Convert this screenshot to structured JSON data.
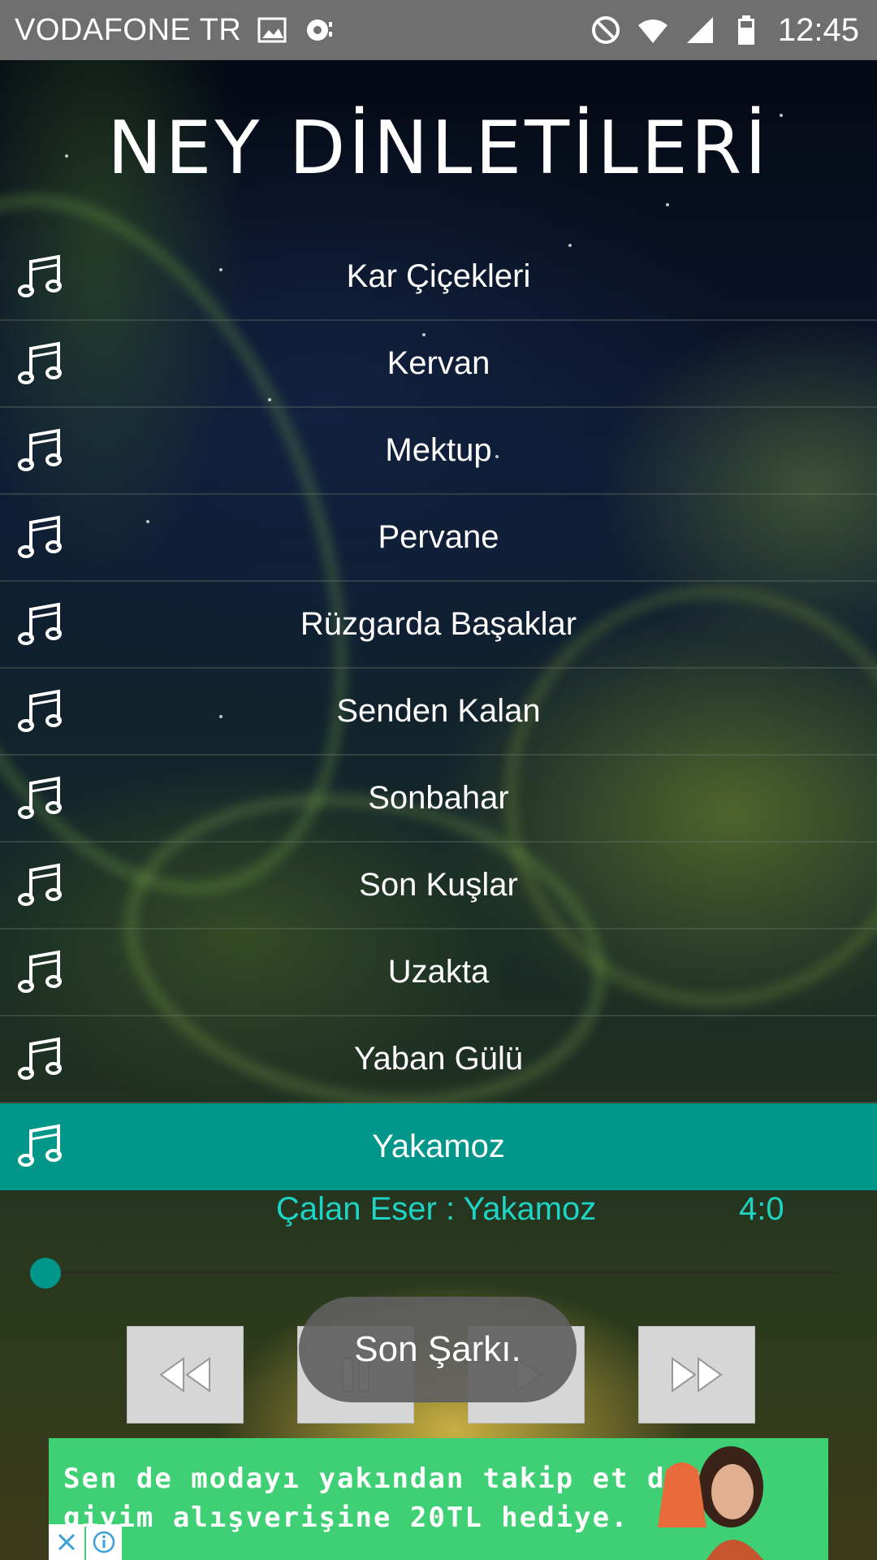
{
  "status_bar": {
    "carrier": "VODAFONE TR",
    "time": "12:45",
    "icons": [
      "image-icon",
      "cast-icon",
      "do-not-disturb-icon",
      "wifi-icon",
      "signal-icon",
      "battery-icon"
    ]
  },
  "title": "NEY DİNLETİLERİ",
  "tracks": [
    {
      "label": "Kar Çiçekleri"
    },
    {
      "label": "Kervan"
    },
    {
      "label": "Mektup"
    },
    {
      "label": "Pervane"
    },
    {
      "label": "Rüzgarda Başaklar"
    },
    {
      "label": "Senden Kalan"
    },
    {
      "label": "Sonbahar"
    },
    {
      "label": "Son Kuşlar"
    },
    {
      "label": "Uzakta"
    },
    {
      "label": "Yaban Gülü"
    },
    {
      "label": "Yakamoz"
    }
  ],
  "active_track_index": 10,
  "now_playing": {
    "text": "Çalan Eser : Yakamoz",
    "duration": "4:0",
    "progress": 0
  },
  "controls": [
    "rewind-button",
    "pause-button",
    "play-button",
    "fast-forward-button"
  ],
  "toast": "Son Şarkı.",
  "ad": {
    "line1": "Sen de modayı yakından takip et diye",
    "line2": "giyim alışverişine 20TL hediye."
  },
  "colors": {
    "status_bar": "#6f6f6f",
    "accent": "#00968a",
    "now_playing_text": "#1ed4c4",
    "ad_background": "#3fcf74"
  }
}
